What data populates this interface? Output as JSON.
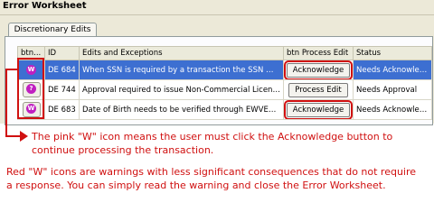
{
  "window": {
    "title": "Error Worksheet"
  },
  "tab": {
    "label": "Discretionary Edits"
  },
  "columns": [
    "btn...",
    "ID",
    "Edits and Exceptions",
    "btn Process Edit",
    "Status"
  ],
  "rows": [
    {
      "icon": "W",
      "id": "DE 684",
      "edit": "When SSN is required by a transaction the SSN must ...",
      "button": "Acknowledge",
      "status": "Needs Acknowled..."
    },
    {
      "icon": "?",
      "id": "DE 744",
      "edit": "Approval required to issue Non-Commercial License wi...",
      "button": "Process Edit",
      "status": "Needs Approval"
    },
    {
      "icon": "W",
      "id": "DE 683",
      "edit": "Date of Birth needs to be verified through EWVER unl...",
      "button": "Acknowledge",
      "status": "Needs Acknowled..."
    }
  ],
  "notes": {
    "pink_w": "The pink \"W\" icon means the user must click the Acknowledge button to continue processing the transaction.",
    "red_w": "Red \"W\" icons are warnings with less significant consequences that do not require a response. You can simply read the warning and close the Error Worksheet."
  },
  "colors": {
    "highlight": "#d01010",
    "icon_pink": "#c020c0",
    "selected_row": "#3d6fd1"
  }
}
